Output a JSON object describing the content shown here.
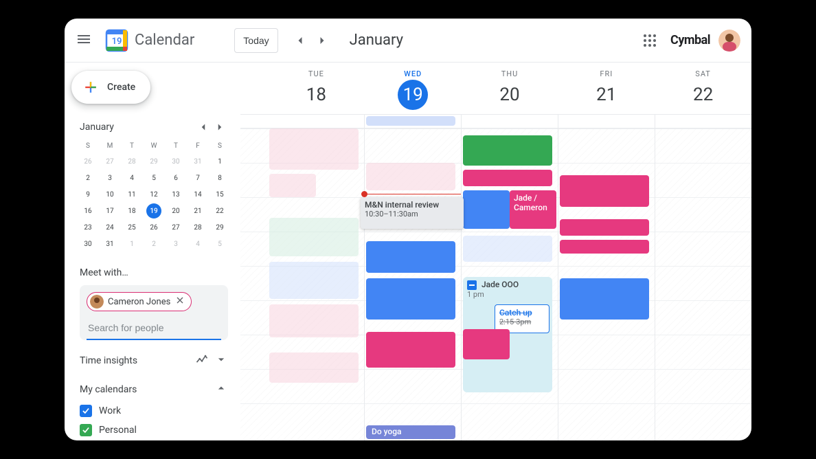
{
  "header": {
    "app_name": "Calendar",
    "today_label": "Today",
    "month_title": "January",
    "brand": "Cymbal",
    "logo_day": "19"
  },
  "sidebar": {
    "create_label": "Create",
    "mini_month_title": "January",
    "dow": [
      "S",
      "M",
      "T",
      "W",
      "T",
      "F",
      "S"
    ],
    "cells": [
      {
        "n": "26",
        "out": true
      },
      {
        "n": "27",
        "out": true
      },
      {
        "n": "28",
        "out": true
      },
      {
        "n": "29",
        "out": true
      },
      {
        "n": "30",
        "out": true
      },
      {
        "n": "31",
        "out": true
      },
      {
        "n": "1"
      },
      {
        "n": "2"
      },
      {
        "n": "3"
      },
      {
        "n": "4"
      },
      {
        "n": "5"
      },
      {
        "n": "6"
      },
      {
        "n": "7"
      },
      {
        "n": "8"
      },
      {
        "n": "9"
      },
      {
        "n": "10"
      },
      {
        "n": "11"
      },
      {
        "n": "12"
      },
      {
        "n": "13"
      },
      {
        "n": "14"
      },
      {
        "n": "15"
      },
      {
        "n": "16"
      },
      {
        "n": "17"
      },
      {
        "n": "18"
      },
      {
        "n": "19",
        "today": true
      },
      {
        "n": "20"
      },
      {
        "n": "21"
      },
      {
        "n": "22"
      },
      {
        "n": "23"
      },
      {
        "n": "24"
      },
      {
        "n": "25"
      },
      {
        "n": "26"
      },
      {
        "n": "27"
      },
      {
        "n": "28"
      },
      {
        "n": "29"
      },
      {
        "n": "30"
      },
      {
        "n": "31"
      },
      {
        "n": "1",
        "out": true
      },
      {
        "n": "2",
        "out": true
      },
      {
        "n": "3",
        "out": true
      },
      {
        "n": "4",
        "out": true
      },
      {
        "n": "5",
        "out": true
      }
    ],
    "meet_with_label": "Meet with…",
    "meet_chip_name": "Cameron Jones",
    "search_placeholder": "Search for people",
    "time_insights_label": "Time insights",
    "my_calendars_label": "My calendars",
    "cal_items": [
      {
        "label": "Work",
        "color": "#1a73e8"
      },
      {
        "label": "Personal",
        "color": "#34a853"
      }
    ]
  },
  "days": [
    {
      "dow": "TUE",
      "num": "18",
      "today": false
    },
    {
      "dow": "WED",
      "num": "19",
      "today": true
    },
    {
      "dow": "THU",
      "num": "20",
      "today": false
    },
    {
      "dow": "FRI",
      "num": "21",
      "today": false
    },
    {
      "dow": "SAT",
      "num": "22",
      "today": false
    }
  ],
  "events": {
    "popover_title": "M&N internal review",
    "popover_time": "10:30–11:30am",
    "jade_cameron": "Jade / Cameron",
    "jade_ooo_title": "Jade OOO",
    "jade_ooo_time": "1 pm",
    "catchup_title": "Catch up",
    "catchup_time": "2:15-3pm",
    "doyoga": "Do yoga"
  },
  "colors": {
    "blue": "#4285f4",
    "blue_l": "#d2e0fb",
    "paleblue": "#c9d8fb",
    "pink_l": "#f7d3de",
    "pink": "#e6397f",
    "green": "#34a853",
    "green_l": "#d4ece0",
    "indigo": "#7685d8"
  }
}
